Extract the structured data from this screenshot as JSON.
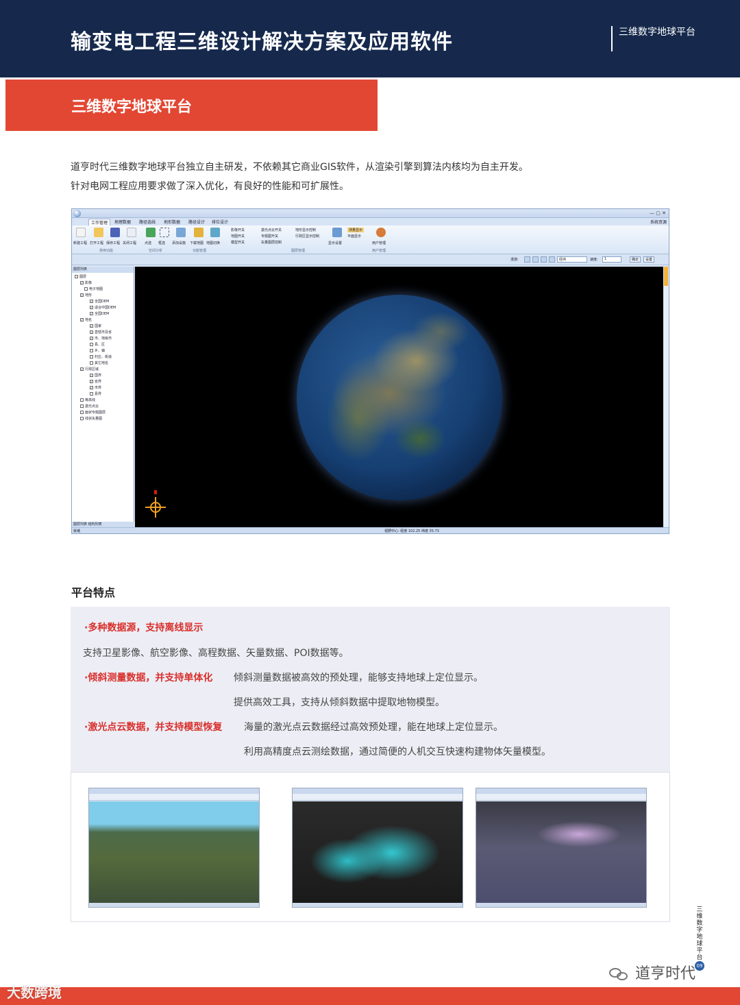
{
  "header": {
    "title": "输变电工程三维设计解决方案及应用软件",
    "right_label": "三维数字地球平台"
  },
  "banner": {
    "title": "三维数字地球平台"
  },
  "intro": {
    "line1": "道亨时代三维数字地球平台独立自主研发，不依赖其它商业GIS软件，从渲染引擎到算法内核均为自主开发。",
    "line2": "针对电网工程应用要求做了深入优化，有良好的性能和可扩展性。"
  },
  "app": {
    "window_controls": "— ▢ ✕",
    "menu": [
      "工作管理",
      "地理数据",
      "路径选线",
      "地形数据",
      "路径设计",
      "排位设计",
      "系统资源"
    ],
    "ribbon_buttons": [
      "新建工程",
      "打开工程",
      "保存工程",
      "关闭工程",
      "点选",
      "框选",
      "添加设施",
      "下载地图",
      "地图切换",
      "显示设置",
      "用户管理"
    ],
    "ribbon_groups": [
      "常用功能",
      "空间分析",
      "功能管理",
      "图层管理",
      "用户管理"
    ],
    "ribbon_checks": [
      "影像开关",
      "激光点云开关",
      "地形显示控制",
      "地图开关",
      "专题图开关",
      "行政区显示控制",
      "模型开关",
      "矢量图层控制",
      "植被显示控制"
    ],
    "ribbon_hi": [
      "测量显示",
      "平面显示"
    ],
    "toolrow": {
      "label1": "漫游:",
      "box1": "经纬",
      "label2": "速度:",
      "box2": "1",
      "btn1": "确定",
      "btn2": "设置"
    },
    "tree_header": "图层列表",
    "tree": [
      "图层",
      "影像",
      "电子地图",
      "地形",
      "全国DEM",
      "适合中国DEM",
      "全国DEM",
      "地名",
      "国家",
      "直辖市及省",
      "市、地级市",
      "县、区",
      "乡、镇",
      "村庄、街道",
      "其它地名",
      "行政区域",
      "国界",
      "省界",
      "市界",
      "县界",
      "等高线",
      "激光点云",
      "面状专题图层",
      "线状矢量图"
    ],
    "tree_tabs": "图层列表  结构列表",
    "status_left": "就绪",
    "status_mid": "视野中心: 经度 102.25 纬度 35.73"
  },
  "features": {
    "section_title": "平台特点",
    "items": [
      {
        "head": "·多种数据源，支持离线显示",
        "desc": [
          "支持卫星影像、航空影像、高程数据、矢量数据、POI数据等。"
        ]
      },
      {
        "head": "·倾斜测量数据，并支持单体化",
        "desc": [
          "倾斜测量数据被高效的预处理，能够支持地球上定位显示。",
          "提供高效工具，支持从倾斜数据中提取地物模型。"
        ]
      },
      {
        "head": "·激光点云数据，并支持模型恢复",
        "desc": [
          "海量的激光点云数据经过高效预处理，能在地球上定位显示。",
          "利用高精度点云测绘数据，通过简便的人机交互快速构建物体矢量模型。"
        ]
      }
    ]
  },
  "side": {
    "vertical": [
      "三",
      "维",
      "数",
      "字",
      "地",
      "球",
      "平",
      "台"
    ],
    "page": "09"
  },
  "footer": {
    "wechat": "道亨时代",
    "watermark": "大数跨境"
  },
  "colors": {
    "navy": "#16294d",
    "accent_red": "#e24733",
    "feature_red": "#d92f2c",
    "panel_bg": "#edeef5"
  }
}
